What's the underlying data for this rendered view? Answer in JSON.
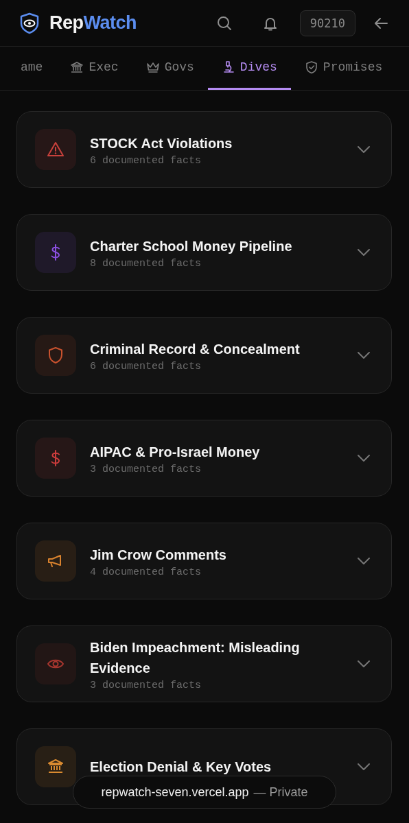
{
  "header": {
    "brand": {
      "first": "Rep",
      "second": "Watch"
    },
    "zip": "90210"
  },
  "tabs": [
    {
      "label": "ame",
      "selected": false
    },
    {
      "label": "Exec",
      "selected": false
    },
    {
      "label": "Govs",
      "selected": false
    },
    {
      "label": "Dives",
      "selected": true
    },
    {
      "label": "Promises",
      "selected": false
    }
  ],
  "dives": [
    {
      "title": "STOCK Act Violations",
      "subtitle": "6 documented facts",
      "color": "#c8413c"
    },
    {
      "title": "Charter School Money Pipeline",
      "subtitle": "8 documented facts",
      "color": "#8a4fe0"
    },
    {
      "title": "Criminal Record & Concealment",
      "subtitle": "6 documented facts",
      "color": "#c9522e"
    },
    {
      "title": "AIPAC & Pro-Israel Money",
      "subtitle": "3 documented facts",
      "color": "#cc3c3c"
    },
    {
      "title": "Jim Crow Comments",
      "subtitle": "4 documented facts",
      "color": "#d9822e"
    },
    {
      "title": "Biden Impeachment: Misleading Evidence",
      "subtitle": "3 documented facts",
      "color": "#a8362f"
    },
    {
      "title": "Election Denial & Key Votes",
      "color": "#d98a30"
    }
  ],
  "url_pill": {
    "address": "repwatch-seven.vercel.app",
    "label": "— Private"
  }
}
